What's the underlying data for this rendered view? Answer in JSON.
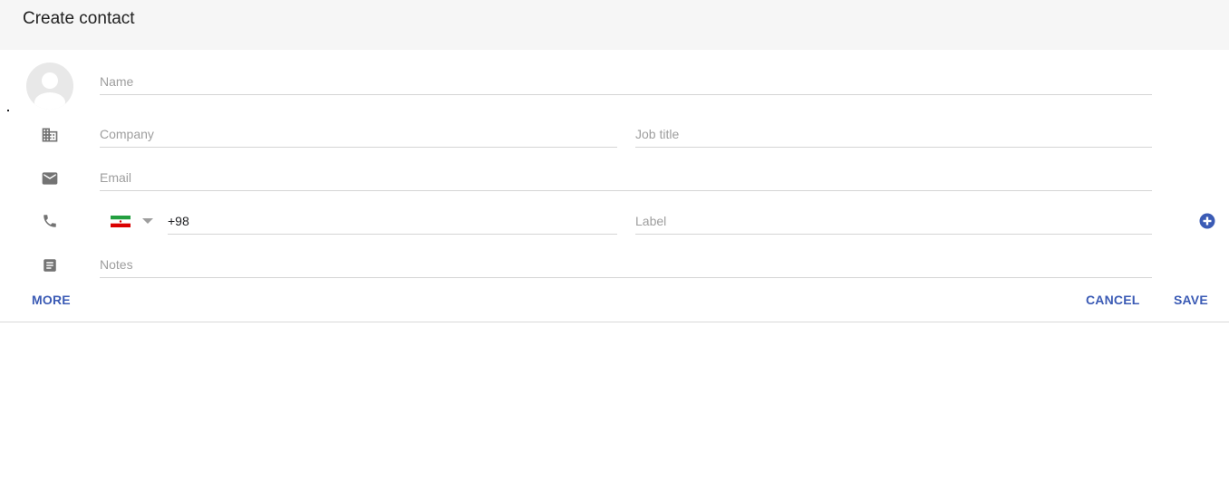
{
  "header": {
    "title": "Create contact"
  },
  "form": {
    "name_placeholder": "Name",
    "company_placeholder": "Company",
    "job_title_placeholder": "Job title",
    "email_placeholder": "Email",
    "phone_value": "+98",
    "label_placeholder": "Label",
    "notes_placeholder": "Notes"
  },
  "icons": {
    "avatar": "person-icon",
    "company": "building-icon",
    "email": "envelope-icon",
    "phone": "phone-icon",
    "notes": "notes-icon",
    "add_phone": "plus-circle-icon",
    "country": "iran-flag-icon"
  },
  "footer": {
    "more_label": "MORE",
    "cancel_label": "CANCEL",
    "save_label": "SAVE"
  },
  "colors": {
    "accent": "#3b5bb5",
    "icon": "#737373",
    "header_bg": "#f6f6f6"
  }
}
